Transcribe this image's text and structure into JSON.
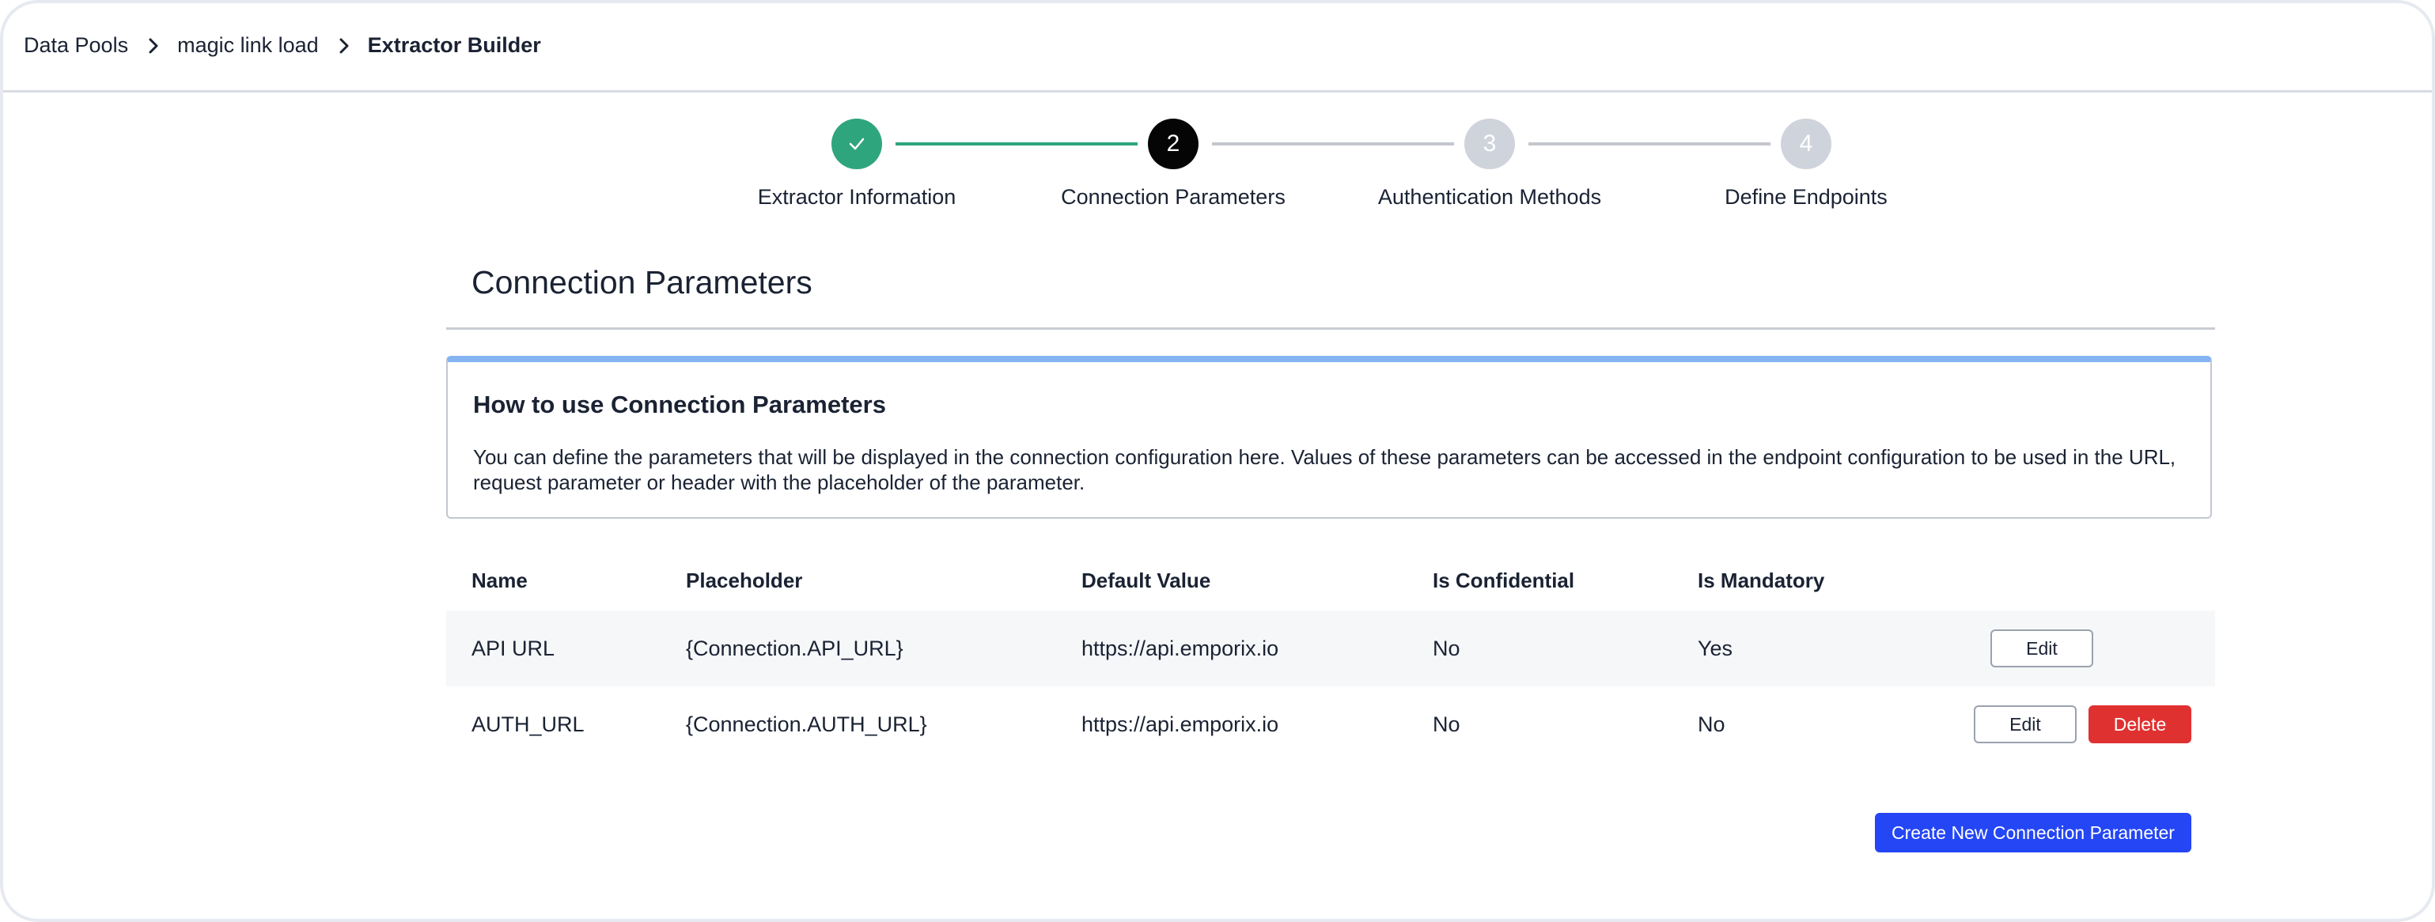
{
  "breadcrumb": {
    "items": [
      "Data Pools",
      "magic link load",
      "Extractor Builder"
    ]
  },
  "stepper": {
    "steps": [
      {
        "number": "1",
        "label": "Extractor Information",
        "state": "done"
      },
      {
        "number": "2",
        "label": "Connection Parameters",
        "state": "active"
      },
      {
        "number": "3",
        "label": "Authentication Methods",
        "state": "todo"
      },
      {
        "number": "4",
        "label": "Define Endpoints",
        "state": "todo"
      }
    ]
  },
  "section": {
    "title": "Connection Parameters"
  },
  "info_box": {
    "title": "How to use Connection Parameters",
    "text": "You can define the parameters that will be displayed in the connection configuration here. Values of these parameters can be accessed in the endpoint configuration to be used in the URL, request parameter or header with the placeholder of the parameter."
  },
  "table": {
    "headers": [
      "Name",
      "Placeholder",
      "Default Value",
      "Is Confidential",
      "Is Mandatory"
    ],
    "rows": [
      {
        "name": "API URL",
        "placeholder": "{Connection.API_URL}",
        "default_value": "https://api.emporix.io",
        "is_confidential": "No",
        "is_mandatory": "Yes",
        "edit_label": "Edit"
      },
      {
        "name": "AUTH_URL",
        "placeholder": "{Connection.AUTH_URL}",
        "default_value": "https://api.emporix.io",
        "is_confidential": "No",
        "is_mandatory": "No",
        "edit_label": "Edit",
        "delete_label": "Delete"
      }
    ]
  },
  "actions": {
    "create_label": "Create New Connection Parameter"
  },
  "colors": {
    "done": "#2fa57d",
    "active": "#050505",
    "todo": "#cfd3dc",
    "info_accent": "#86b4f2",
    "delete": "#e03131",
    "primary": "#2446f5"
  },
  "icons": {
    "done_step": "check-icon",
    "breadcrumb_separator": "chevron-right-icon"
  }
}
